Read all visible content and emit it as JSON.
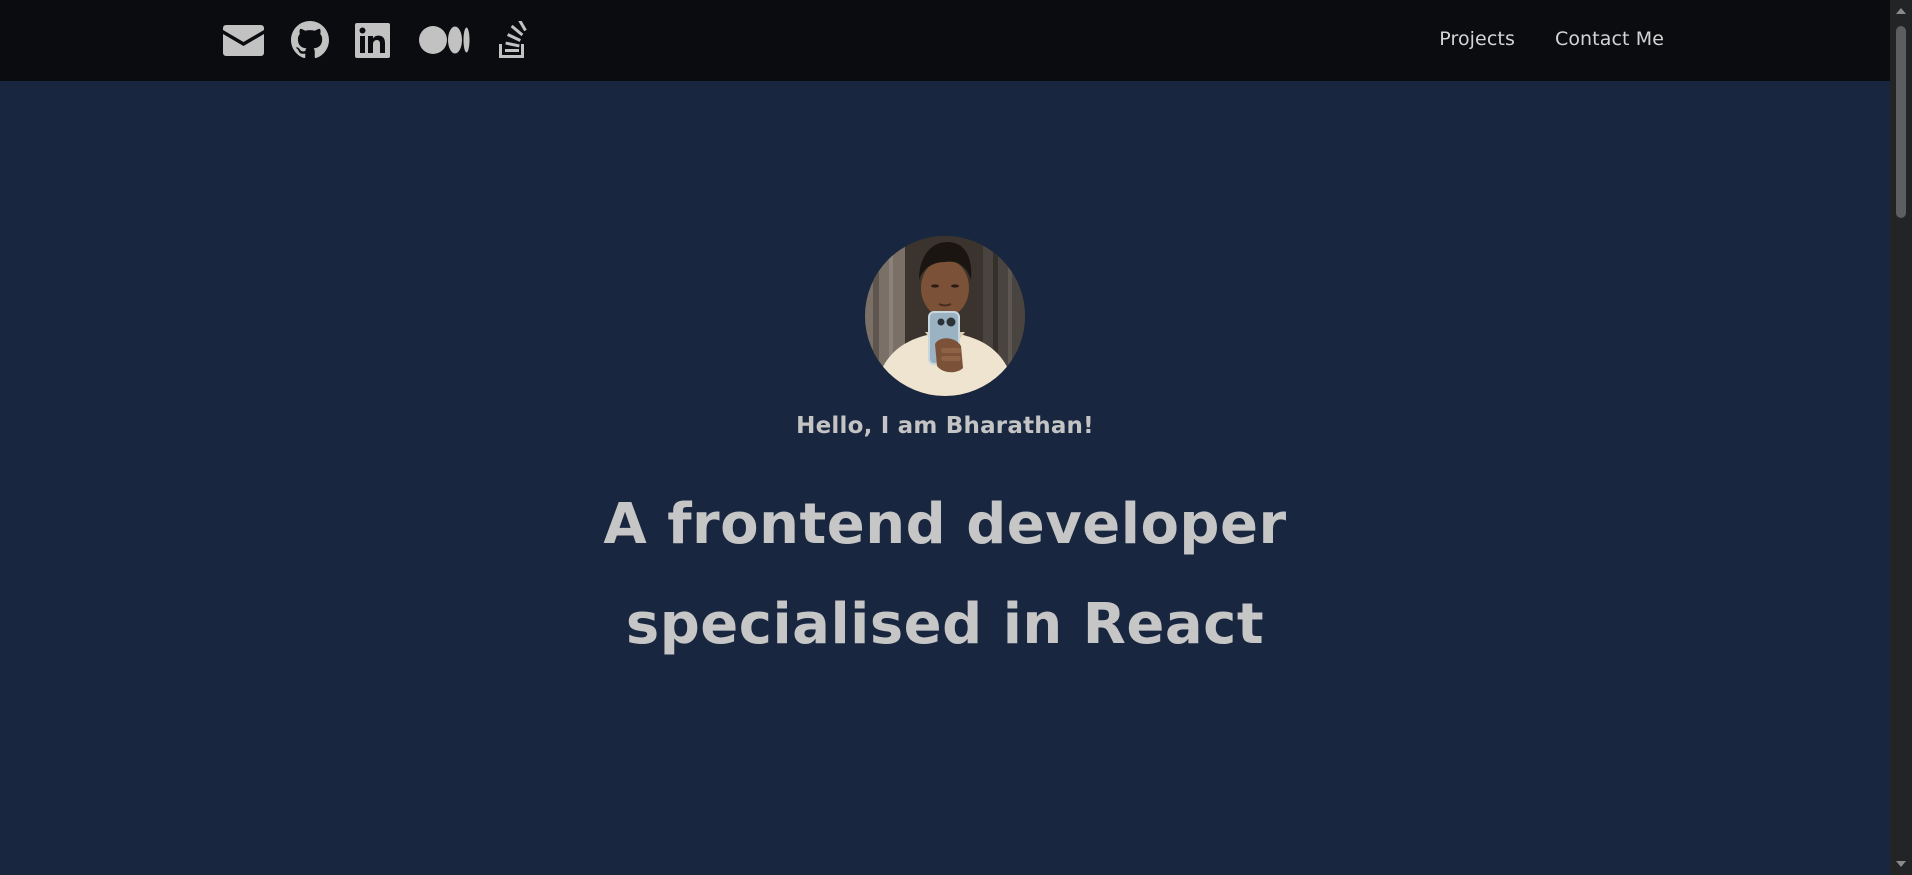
{
  "header": {
    "social_icons": [
      {
        "name": "mail-icon"
      },
      {
        "name": "github-icon"
      },
      {
        "name": "linkedin-icon"
      },
      {
        "name": "medium-icon"
      },
      {
        "name": "stackoverflow-icon"
      }
    ],
    "nav": {
      "projects_label": "Projects",
      "contact_label": "Contact Me"
    }
  },
  "hero": {
    "avatar_icon": "profile-photo",
    "greeting": "Hello, I am Bharathan!",
    "headline_line1": "A frontend developer",
    "headline_line2": "specialised in React"
  },
  "colors": {
    "header_bg": "#0a0c0f",
    "page_bg": "#18263f",
    "text": "#c6c6c6"
  }
}
